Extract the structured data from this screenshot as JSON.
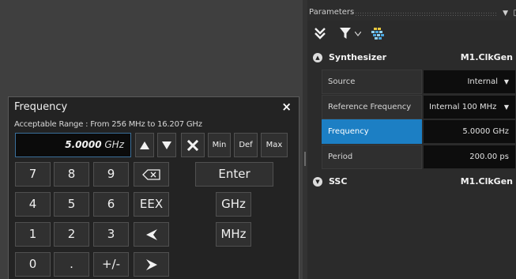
{
  "dialog": {
    "title": "Frequency",
    "close_glyph": "×",
    "range_text": "Acceptable Range : From 256 MHz to 16.207 GHz",
    "entry_value": "5.0000",
    "entry_unit": "GHz",
    "tool_buttons": {
      "up_icon": "triangle-up-icon",
      "down_icon": "triangle-down-icon",
      "clear_icon": "x-clear-icon",
      "min": "Min",
      "def": "Def",
      "max": "Max"
    },
    "keypad": {
      "k7": "7",
      "k8": "8",
      "k9": "9",
      "k4": "4",
      "k5": "5",
      "k6": "6",
      "k1": "1",
      "k2": "2",
      "k3": "3",
      "k0": "0",
      "dot": ".",
      "plusminus": "+/-",
      "eex": "EEX",
      "enter": "Enter",
      "ghz": "GHz",
      "mhz": "MHz",
      "backspace_icon": "backspace-icon",
      "left_icon": "arrow-left-icon",
      "right_icon": "arrow-right-icon"
    }
  },
  "parameters": {
    "title": "Parameters",
    "toolbar_icons": [
      "collapse-all-icon",
      "filter-icon",
      "filter-dropdown-icon",
      "grid-icon"
    ],
    "sections": [
      {
        "name": "Synthesizer",
        "ref": "M1.ClkGen",
        "state": "expanded"
      },
      {
        "name": "SSC",
        "ref": "M1.ClkGen",
        "state": "collapsed"
      }
    ],
    "rows": [
      {
        "label": "Source",
        "value": "Internal",
        "dropdown": true
      },
      {
        "label": "Reference Frequency",
        "value": "Internal 100 MHz",
        "dropdown": true
      },
      {
        "label": "Frequency",
        "value": "5.0000 GHz",
        "selected": true
      },
      {
        "label": "Period",
        "value": "200.00 ps"
      }
    ]
  },
  "colors": {
    "accent": "#1c7fc4",
    "entry_border": "#3a6f9a",
    "background": "#2b2b2b"
  }
}
